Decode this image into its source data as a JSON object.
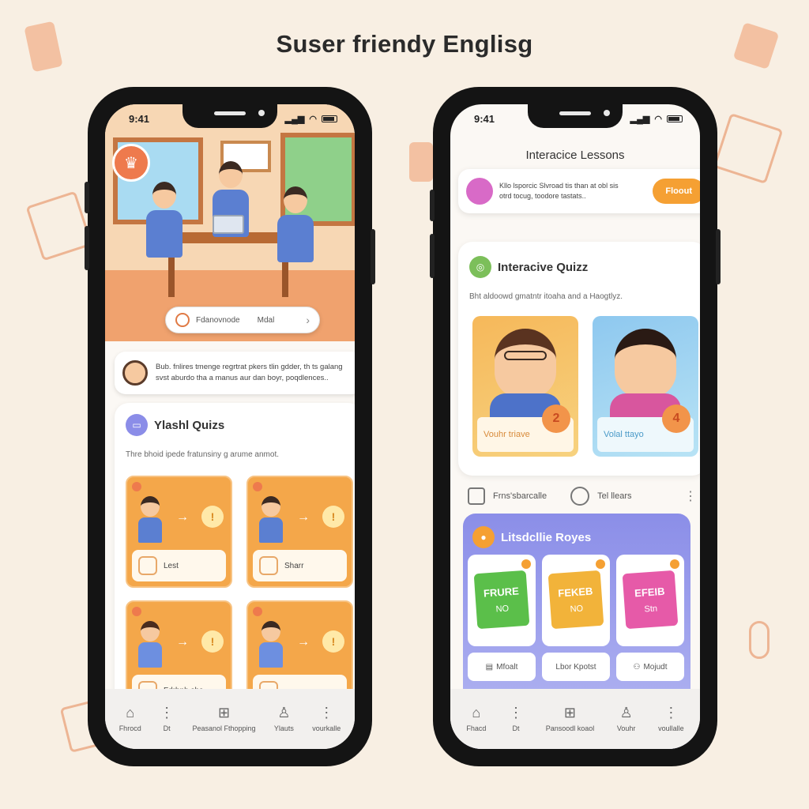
{
  "title": "Suser friendy Englisg",
  "left_phone": {
    "status_time": "9:41",
    "search": {
      "placeholder": "Fdanovnode",
      "value": "Mdal"
    },
    "message": {
      "line1": "Bub. fnlires tmenge regrtrat pkers tlin gdder, th ts galang",
      "line2": "svst aburdo tha a manus aur dan boyr, poqdlences.."
    },
    "quiz": {
      "title": "Ylashl Quizs",
      "subtitle": "Thre bhoid ipede fratunsiny g arume anmot.",
      "cards": [
        {
          "label": "Lest"
        },
        {
          "label": "Sharr"
        },
        {
          "label": "Fdrhnh sha"
        },
        {
          "label": ""
        }
      ]
    },
    "tabs": [
      "Fhrocd",
      "Dt",
      "Peasanol Fthopping",
      "Ylauts",
      "vourkalle"
    ]
  },
  "right_phone": {
    "status_time": "9:41",
    "title": "Interacice Lessons",
    "banner": {
      "line1": "Kllo lsporcic Slvroad  tis than at obl sis",
      "line2": "otrd tocug, toodore tastats..",
      "button": "Floout"
    },
    "quiz": {
      "title": "Interacive Quizz",
      "subtitle": "Bht aldoowd gmatntr itoaha and a Haogtlyz.",
      "cards": [
        {
          "label": "Vouhr triave",
          "badge": "2"
        },
        {
          "label": "Volal ttayo",
          "badge": "4"
        }
      ]
    },
    "row": {
      "left": "Frns'sbarcalle",
      "right": "Tel llears"
    },
    "roles": {
      "title": "Litsdcllie Royes",
      "stickers": [
        {
          "top": "FRURE",
          "bottom": "NO",
          "color": "#5bbf4a"
        },
        {
          "top": "FEKEB",
          "bottom": "NO",
          "color": "#f2b33a"
        },
        {
          "top": "EFEIB",
          "bottom": "Stn",
          "color": "#e65aa8"
        }
      ],
      "labels": [
        "Mfoalt",
        "Lbor Kpotst",
        "Mojudt"
      ]
    },
    "tabs": [
      "Fhacd",
      "Dt",
      "Pansoodl koaol",
      "Vouhr",
      "voullalle"
    ]
  },
  "colors": {
    "accent_orange": "#f5a033",
    "accent_purple": "#8b8ee8",
    "background": "#f8efe3"
  }
}
